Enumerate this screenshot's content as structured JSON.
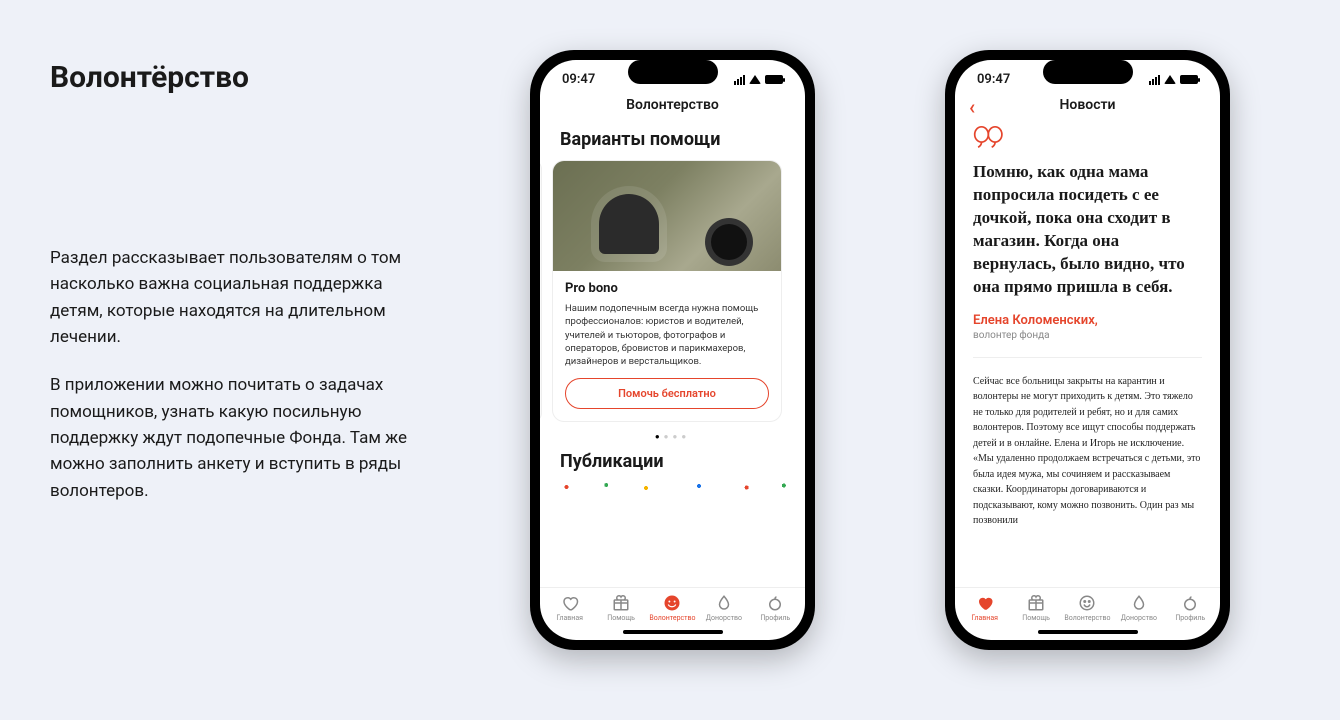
{
  "page_title": "Волонтёрство",
  "description": {
    "p1": "Раздел рассказывает пользователям о том насколько важна социальная поддержка детям, которые находятся на длительном лечении.",
    "p2": "В приложении можно почитать о задачах помощников, узнать какую посильную поддержку ждут подопечные Фонда. Там же можно заполнить анкету и вступить в ряды волонтеров."
  },
  "status": {
    "time": "09:47"
  },
  "phone1": {
    "nav_title": "Волонтерство",
    "section1_title": "Варианты помощи",
    "card": {
      "title": "Pro bono",
      "text": "Нашим подопечным всегда нужна помощь профессионалов: юристов и водителей, учителей и тьюторов, фотографов и операторов, бровистов и парикмахеров, дизайнеров и верстальщиков.",
      "button": "Помочь бесплатно"
    },
    "section2_title": "Публикации"
  },
  "phone2": {
    "nav_title": "Новости",
    "quote": "Помню, как одна мама попросила посидеть с ее дочкой, пока она сходит в магазин. Когда она вернулась, было видно, что она прямо пришла в себя.",
    "author": "Елена Коломенских,",
    "author_role": "волонтер фонда",
    "article": "Сейчас все больницы закрыты на карантин и волонтеры не могут приходить к детям. Это тяжело не только для родителей и ребят, но и для самих волонтеров. Поэтому все ищут способы поддержать детей и в онлайне. Елена и Игорь не исключение. «Мы удаленно продолжаем встречаться с детьми, это была идея мужа, мы сочиняем и рассказываем сказки. Координаторы договариваются и подсказывают, кому можно позвонить. Один раз мы позвонили"
  },
  "tabs": {
    "home": "Главная",
    "help": "Помощь",
    "vol": "Волонтерство",
    "donor": "Донорство",
    "profile": "Профиль"
  }
}
